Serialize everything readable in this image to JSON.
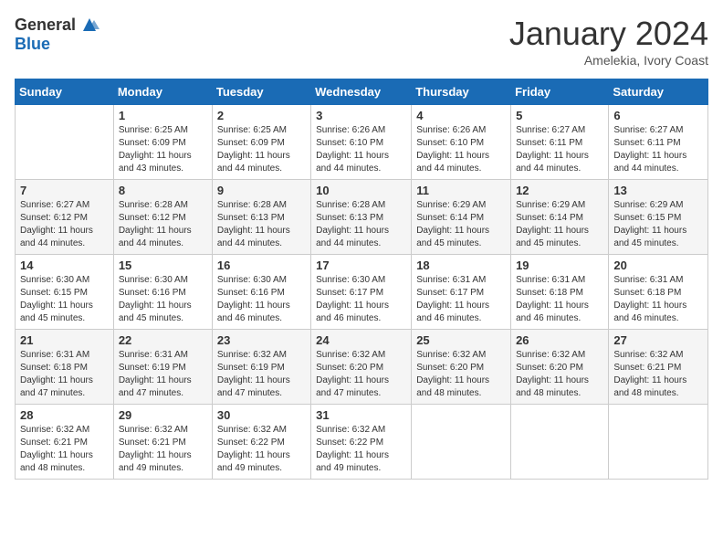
{
  "header": {
    "logo_general": "General",
    "logo_blue": "Blue",
    "month_title": "January 2024",
    "subtitle": "Amelekia, Ivory Coast"
  },
  "weekdays": [
    "Sunday",
    "Monday",
    "Tuesday",
    "Wednesday",
    "Thursday",
    "Friday",
    "Saturday"
  ],
  "weeks": [
    [
      {
        "day": "",
        "info": ""
      },
      {
        "day": "1",
        "info": "Sunrise: 6:25 AM\nSunset: 6:09 PM\nDaylight: 11 hours\nand 43 minutes."
      },
      {
        "day": "2",
        "info": "Sunrise: 6:25 AM\nSunset: 6:09 PM\nDaylight: 11 hours\nand 44 minutes."
      },
      {
        "day": "3",
        "info": "Sunrise: 6:26 AM\nSunset: 6:10 PM\nDaylight: 11 hours\nand 44 minutes."
      },
      {
        "day": "4",
        "info": "Sunrise: 6:26 AM\nSunset: 6:10 PM\nDaylight: 11 hours\nand 44 minutes."
      },
      {
        "day": "5",
        "info": "Sunrise: 6:27 AM\nSunset: 6:11 PM\nDaylight: 11 hours\nand 44 minutes."
      },
      {
        "day": "6",
        "info": "Sunrise: 6:27 AM\nSunset: 6:11 PM\nDaylight: 11 hours\nand 44 minutes."
      }
    ],
    [
      {
        "day": "7",
        "info": "Sunrise: 6:27 AM\nSunset: 6:12 PM\nDaylight: 11 hours\nand 44 minutes."
      },
      {
        "day": "8",
        "info": "Sunrise: 6:28 AM\nSunset: 6:12 PM\nDaylight: 11 hours\nand 44 minutes."
      },
      {
        "day": "9",
        "info": "Sunrise: 6:28 AM\nSunset: 6:13 PM\nDaylight: 11 hours\nand 44 minutes."
      },
      {
        "day": "10",
        "info": "Sunrise: 6:28 AM\nSunset: 6:13 PM\nDaylight: 11 hours\nand 44 minutes."
      },
      {
        "day": "11",
        "info": "Sunrise: 6:29 AM\nSunset: 6:14 PM\nDaylight: 11 hours\nand 45 minutes."
      },
      {
        "day": "12",
        "info": "Sunrise: 6:29 AM\nSunset: 6:14 PM\nDaylight: 11 hours\nand 45 minutes."
      },
      {
        "day": "13",
        "info": "Sunrise: 6:29 AM\nSunset: 6:15 PM\nDaylight: 11 hours\nand 45 minutes."
      }
    ],
    [
      {
        "day": "14",
        "info": "Sunrise: 6:30 AM\nSunset: 6:15 PM\nDaylight: 11 hours\nand 45 minutes."
      },
      {
        "day": "15",
        "info": "Sunrise: 6:30 AM\nSunset: 6:16 PM\nDaylight: 11 hours\nand 45 minutes."
      },
      {
        "day": "16",
        "info": "Sunrise: 6:30 AM\nSunset: 6:16 PM\nDaylight: 11 hours\nand 46 minutes."
      },
      {
        "day": "17",
        "info": "Sunrise: 6:30 AM\nSunset: 6:17 PM\nDaylight: 11 hours\nand 46 minutes."
      },
      {
        "day": "18",
        "info": "Sunrise: 6:31 AM\nSunset: 6:17 PM\nDaylight: 11 hours\nand 46 minutes."
      },
      {
        "day": "19",
        "info": "Sunrise: 6:31 AM\nSunset: 6:18 PM\nDaylight: 11 hours\nand 46 minutes."
      },
      {
        "day": "20",
        "info": "Sunrise: 6:31 AM\nSunset: 6:18 PM\nDaylight: 11 hours\nand 46 minutes."
      }
    ],
    [
      {
        "day": "21",
        "info": "Sunrise: 6:31 AM\nSunset: 6:18 PM\nDaylight: 11 hours\nand 47 minutes."
      },
      {
        "day": "22",
        "info": "Sunrise: 6:31 AM\nSunset: 6:19 PM\nDaylight: 11 hours\nand 47 minutes."
      },
      {
        "day": "23",
        "info": "Sunrise: 6:32 AM\nSunset: 6:19 PM\nDaylight: 11 hours\nand 47 minutes."
      },
      {
        "day": "24",
        "info": "Sunrise: 6:32 AM\nSunset: 6:20 PM\nDaylight: 11 hours\nand 47 minutes."
      },
      {
        "day": "25",
        "info": "Sunrise: 6:32 AM\nSunset: 6:20 PM\nDaylight: 11 hours\nand 48 minutes."
      },
      {
        "day": "26",
        "info": "Sunrise: 6:32 AM\nSunset: 6:20 PM\nDaylight: 11 hours\nand 48 minutes."
      },
      {
        "day": "27",
        "info": "Sunrise: 6:32 AM\nSunset: 6:21 PM\nDaylight: 11 hours\nand 48 minutes."
      }
    ],
    [
      {
        "day": "28",
        "info": "Sunrise: 6:32 AM\nSunset: 6:21 PM\nDaylight: 11 hours\nand 48 minutes."
      },
      {
        "day": "29",
        "info": "Sunrise: 6:32 AM\nSunset: 6:21 PM\nDaylight: 11 hours\nand 49 minutes."
      },
      {
        "day": "30",
        "info": "Sunrise: 6:32 AM\nSunset: 6:22 PM\nDaylight: 11 hours\nand 49 minutes."
      },
      {
        "day": "31",
        "info": "Sunrise: 6:32 AM\nSunset: 6:22 PM\nDaylight: 11 hours\nand 49 minutes."
      },
      {
        "day": "",
        "info": ""
      },
      {
        "day": "",
        "info": ""
      },
      {
        "day": "",
        "info": ""
      }
    ]
  ]
}
